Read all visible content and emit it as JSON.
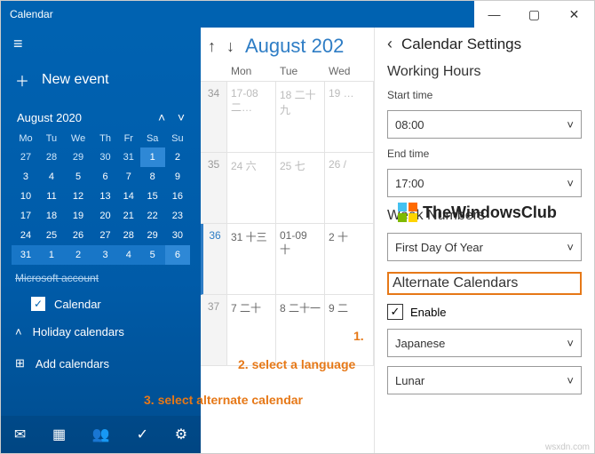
{
  "window": {
    "title": "Calendar"
  },
  "sidebar": {
    "newevent": "New event",
    "minical": {
      "title": "August 2020",
      "dow": [
        "Mo",
        "Tu",
        "We",
        "Th",
        "Fr",
        "Sa",
        "Su"
      ],
      "rows": [
        [
          "27",
          "28",
          "29",
          "30",
          "31",
          "1",
          "2"
        ],
        [
          "3",
          "4",
          "5",
          "6",
          "7",
          "8",
          "9"
        ],
        [
          "10",
          "11",
          "12",
          "13",
          "14",
          "15",
          "16"
        ],
        [
          "17",
          "18",
          "19",
          "20",
          "21",
          "22",
          "23"
        ],
        [
          "24",
          "25",
          "26",
          "27",
          "28",
          "29",
          "30"
        ],
        [
          "31",
          "1",
          "2",
          "3",
          "4",
          "5",
          "6"
        ]
      ]
    },
    "account": "Microsoft account",
    "calendar_label": "Calendar",
    "holiday": "Holiday calendars",
    "addcal": "Add calendars"
  },
  "main": {
    "month": "August 202",
    "dow": [
      "Mon",
      "Tue",
      "Wed"
    ],
    "weeks": [
      "34",
      "35",
      "36",
      "37"
    ],
    "cells": [
      "17-08 二…",
      "18 二十九",
      "19 …",
      "24 六",
      "25 七",
      "26 /",
      "31 十三",
      "01-09 十",
      "2 十",
      "7 二十",
      "8 二十一",
      "9 二"
    ]
  },
  "settings": {
    "title": "Calendar Settings",
    "working_hours": "Working Hours",
    "start_label": "Start time",
    "start_value": "08:00",
    "end_label": "End time",
    "end_value": "17:00",
    "weeknum": "Week Numbers",
    "weeknum_value": "First Day Of Year",
    "altcal": "Alternate Calendars",
    "enable": "Enable",
    "language": "Japanese",
    "calendar_type": "Lunar"
  },
  "annotations": {
    "a1": "1.",
    "a2": "2. select a language",
    "a3": "3. select alternate calendar"
  },
  "brand": "TheWindowsClub",
  "attr": "wsxdn.com"
}
